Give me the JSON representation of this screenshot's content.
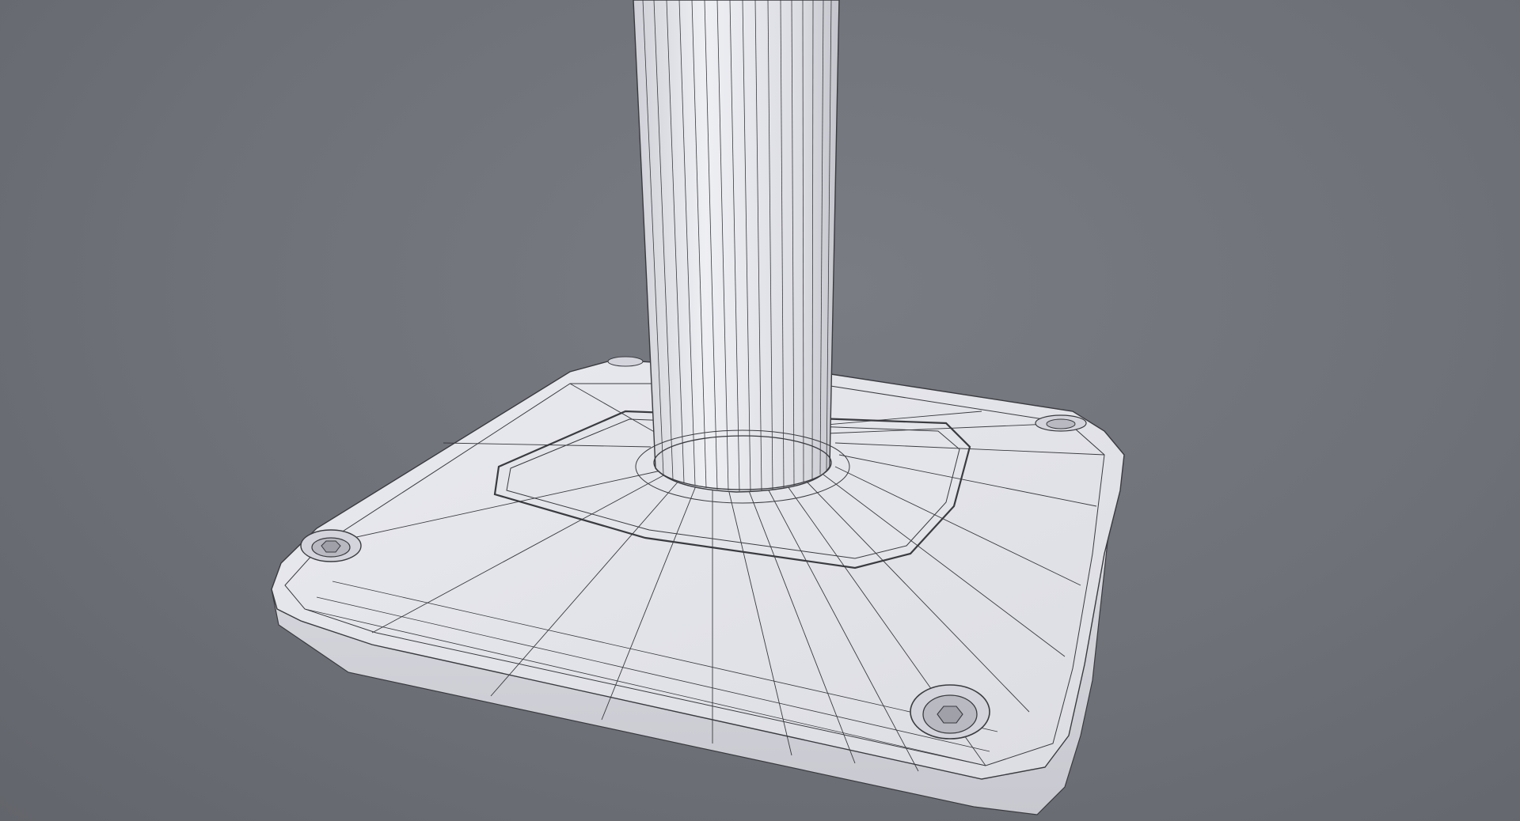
{
  "scene": {
    "subject": "wireframe-render",
    "colors": {
      "background": "#6f7179",
      "surface": "#e6e7ec",
      "surface_shadow": "#c9cad2",
      "wire": "#3a3b40"
    }
  }
}
